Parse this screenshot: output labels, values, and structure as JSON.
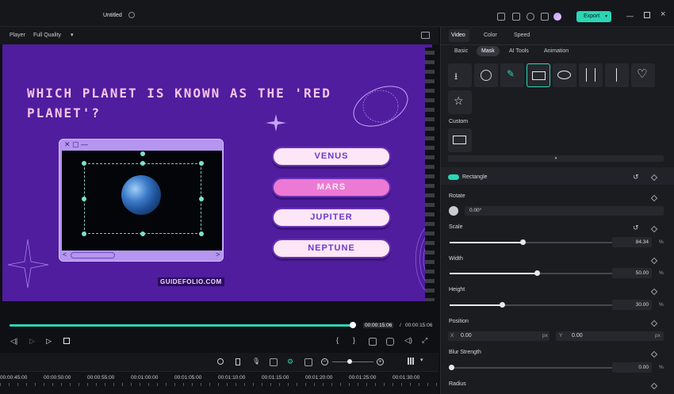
{
  "titlebar": {
    "title": "Untitled",
    "export_label": "Export"
  },
  "player": {
    "label": "Player",
    "quality": "Full Quality",
    "current_time": "00:00:15:06",
    "separator": "/",
    "total_time": "00:00:15:06",
    "progress": 1.0
  },
  "stage": {
    "question": "Which planet is known as the 'red planet'?",
    "answers": [
      "VENUS",
      "MARS",
      "JUPITER",
      "NEPTUNE"
    ],
    "highlighted_answer": "MARS",
    "brand": "GUIDEFOLIO.COM"
  },
  "ruler": {
    "ticks": [
      "00:00:45:00",
      "00:00:50:00",
      "00:00:55:00",
      "00:01:00:00",
      "00:01:05:00",
      "00:01:10:00",
      "00:01:15:00",
      "00:01:20:00",
      "00:01:25:00",
      "00:01:30:00"
    ]
  },
  "panel": {
    "tabs": [
      "Video",
      "Color",
      "Speed"
    ],
    "subtabs": [
      "Basic",
      "Mask",
      "AI Tools",
      "Animation"
    ],
    "custom_label": "Custom",
    "rectangle_label": "Rectangle",
    "rotate": {
      "label": "Rotate",
      "value": "0.00°"
    },
    "scale": {
      "label": "Scale",
      "value": "84.34",
      "unit": "%",
      "level": 0.8434
    },
    "width": {
      "label": "Width",
      "value": "50.00",
      "unit": "%",
      "level": 0.5
    },
    "height": {
      "label": "Height",
      "value": "30.00",
      "unit": "%",
      "level": 0.3
    },
    "position": {
      "label": "Position",
      "x_label": "X",
      "x_value": "0.00",
      "y_label": "Y",
      "y_value": "0.00",
      "unit": "px"
    },
    "blur": {
      "label": "Blur Strength",
      "value": "0.00",
      "unit": "%",
      "level": 0
    },
    "radius_label": "Radius"
  },
  "colors": {
    "accent": "#2bd6b5",
    "stage_bg": "#4f1d9e",
    "answer_pink": "#ec7ad4"
  }
}
